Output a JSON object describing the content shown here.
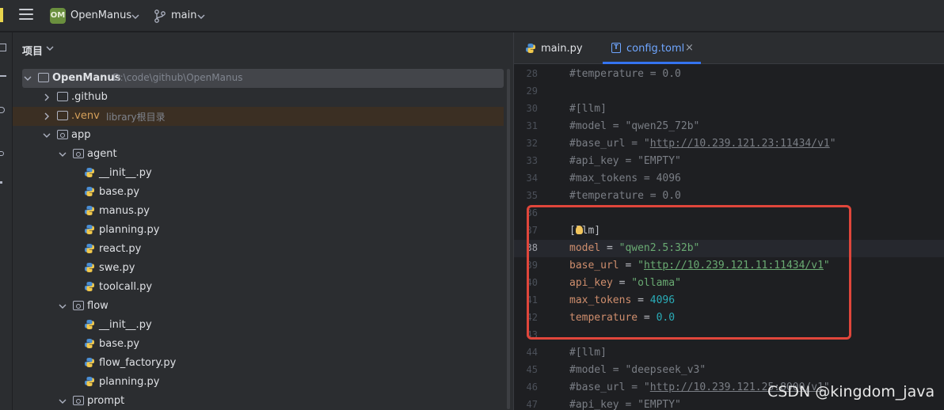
{
  "titlebar": {
    "project_badge": "OM",
    "project_name": "OpenManus",
    "branch_name": "main"
  },
  "project_panel": {
    "title": "项目",
    "tree": [
      {
        "label": "OpenManus",
        "hint": "D:\\code\\github\\OpenManus",
        "type": "root"
      },
      {
        "label": ".github",
        "hint": "",
        "type": "folder"
      },
      {
        "label": ".venv",
        "hint": "library根目录",
        "type": "folder"
      },
      {
        "label": "app",
        "hint": "",
        "type": "package"
      },
      {
        "label": "agent",
        "hint": "",
        "type": "package"
      },
      {
        "label": "__init__.py",
        "hint": "",
        "type": "py"
      },
      {
        "label": "base.py",
        "hint": "",
        "type": "py"
      },
      {
        "label": "manus.py",
        "hint": "",
        "type": "py"
      },
      {
        "label": "planning.py",
        "hint": "",
        "type": "py"
      },
      {
        "label": "react.py",
        "hint": "",
        "type": "py"
      },
      {
        "label": "swe.py",
        "hint": "",
        "type": "py"
      },
      {
        "label": "toolcall.py",
        "hint": "",
        "type": "py"
      },
      {
        "label": "flow",
        "hint": "",
        "type": "package"
      },
      {
        "label": "__init__.py",
        "hint": "",
        "type": "py"
      },
      {
        "label": "base.py",
        "hint": "",
        "type": "py"
      },
      {
        "label": "flow_factory.py",
        "hint": "",
        "type": "py"
      },
      {
        "label": "planning.py",
        "hint": "",
        "type": "py"
      },
      {
        "label": "prompt",
        "hint": "",
        "type": "package"
      }
    ]
  },
  "editor": {
    "tabs": [
      {
        "label": "main.py",
        "active": false
      },
      {
        "label": "config.toml",
        "active": true,
        "icon_text": "T",
        "close": "×"
      }
    ],
    "lines": [
      {
        "n": "28",
        "text": "#temperature = 0.0"
      },
      {
        "n": "29",
        "text": ""
      },
      {
        "n": "30",
        "text": "#[llm]"
      },
      {
        "n": "31",
        "text": "#model = \"qwen25_72b\""
      },
      {
        "n": "32",
        "pre": "#base_url = \"",
        "url": "http://10.239.121.23:11434/v1",
        "post": "\""
      },
      {
        "n": "33",
        "text": "#api_key = \"EMPTY\""
      },
      {
        "n": "34",
        "text": "#max_tokens = 4096"
      },
      {
        "n": "35",
        "text": "#temperature = 0.0"
      },
      {
        "n": "36",
        "text": ""
      },
      {
        "n": "37",
        "text": "[llm]"
      },
      {
        "n": "38",
        "key": "model",
        "eq": " = ",
        "val": "\"qwen2.5:32b\""
      },
      {
        "n": "39",
        "key": "base_url",
        "eq": " = ",
        "pre": "\"",
        "url": "http://10.239.121.11:11434/v1",
        "post": "\""
      },
      {
        "n": "40",
        "key": "api_key",
        "eq": " = ",
        "val": "\"ollama\""
      },
      {
        "n": "41",
        "key": "max_tokens",
        "eq": " = ",
        "num": "4096"
      },
      {
        "n": "42",
        "key": "temperature",
        "eq": " = ",
        "num": "0.0"
      },
      {
        "n": "43",
        "text": ""
      },
      {
        "n": "44",
        "text": "#[llm]"
      },
      {
        "n": "45",
        "text": "#model = \"deepseek_v3\""
      },
      {
        "n": "46",
        "pre": "#base_url = \"",
        "url": "http://10.239.121.25:8000/v1",
        "post": "\""
      },
      {
        "n": "47",
        "text": "#api_key = \"EMPTY\""
      }
    ]
  },
  "watermark": "CSDN @kingdom_java",
  "colors": {
    "accent": "#3574f0",
    "highlight_box": "#e0463b"
  }
}
